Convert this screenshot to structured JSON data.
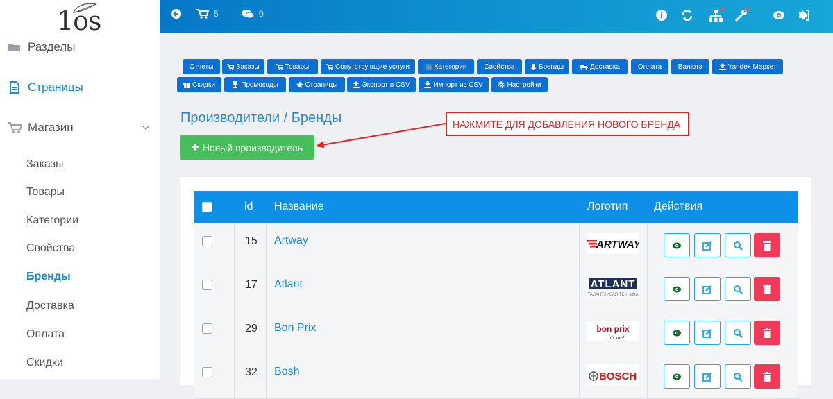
{
  "sidebar": {
    "logo_text": "1os",
    "sections": [
      {
        "label": "Разделы"
      },
      {
        "label": "Страницы"
      },
      {
        "label": "Магазин"
      }
    ],
    "sub_items": [
      {
        "label": "Заказы"
      },
      {
        "label": "Товары"
      },
      {
        "label": "Категории"
      },
      {
        "label": "Свойства"
      },
      {
        "label": "Бренды"
      },
      {
        "label": "Доставка"
      },
      {
        "label": "Оплата"
      },
      {
        "label": "Скидки"
      }
    ]
  },
  "topbar": {
    "cart_count": "5",
    "comments_count": "0"
  },
  "menu": [
    {
      "label": "Отчеты",
      "icon": ""
    },
    {
      "label": "Заказы",
      "icon": "cart-icon"
    },
    {
      "label": "Товары",
      "icon": "cart-icon"
    },
    {
      "label": "Сопутствующие услуги",
      "icon": "cart-icon"
    },
    {
      "label": "Категории",
      "icon": "list-icon"
    },
    {
      "label": "Свойства",
      "icon": ""
    },
    {
      "label": "Бренды",
      "icon": "bell-icon"
    },
    {
      "label": "Доставка",
      "icon": "truck-icon"
    },
    {
      "label": "Оплата",
      "icon": ""
    },
    {
      "label": "Валюта",
      "icon": ""
    },
    {
      "label": "Yandex Маркет",
      "icon": "upload-icon"
    },
    {
      "label": "Скидки",
      "icon": "gift-icon"
    },
    {
      "label": "Промокоды",
      "icon": "trophy-icon"
    },
    {
      "label": "Страницы",
      "icon": "star-icon"
    },
    {
      "label": "Экспорт в CSV",
      "icon": "upload-icon"
    },
    {
      "label": "Импорт из CSV",
      "icon": "download-icon"
    },
    {
      "label": "Настройки",
      "icon": "gear-icon"
    }
  ],
  "page": {
    "title": "Производители / Бренды",
    "new_button": "Новый производитель",
    "callout": "НАЖМИТЕ ДЛЯ ДОБАВЛЕНИЯ НОВОГО БРЕНДА"
  },
  "table": {
    "headers": {
      "id": "id",
      "name": "Название",
      "logo": "Логотип",
      "actions": "Действия"
    },
    "rows": [
      {
        "id": "15",
        "name": "Artway",
        "logo": "ARTWAY",
        "logo_sub": ""
      },
      {
        "id": "17",
        "name": "Atlant",
        "logo": "ATLANT",
        "logo_sub": "ТАЛАНТЛИВАЯ ТЕХНИКА"
      },
      {
        "id": "29",
        "name": "Bon Prix",
        "logo": "bon prix",
        "logo_sub": "it's me!"
      },
      {
        "id": "32",
        "name": "Bosh",
        "logo": "BOSCH",
        "logo_sub": ""
      }
    ]
  },
  "colors": {
    "accent": "#1a8ad6",
    "success": "#46bf5a",
    "danger": "#f03a5a",
    "menu_button": "#0d6fd0",
    "table_header": "#0e8fe8"
  }
}
